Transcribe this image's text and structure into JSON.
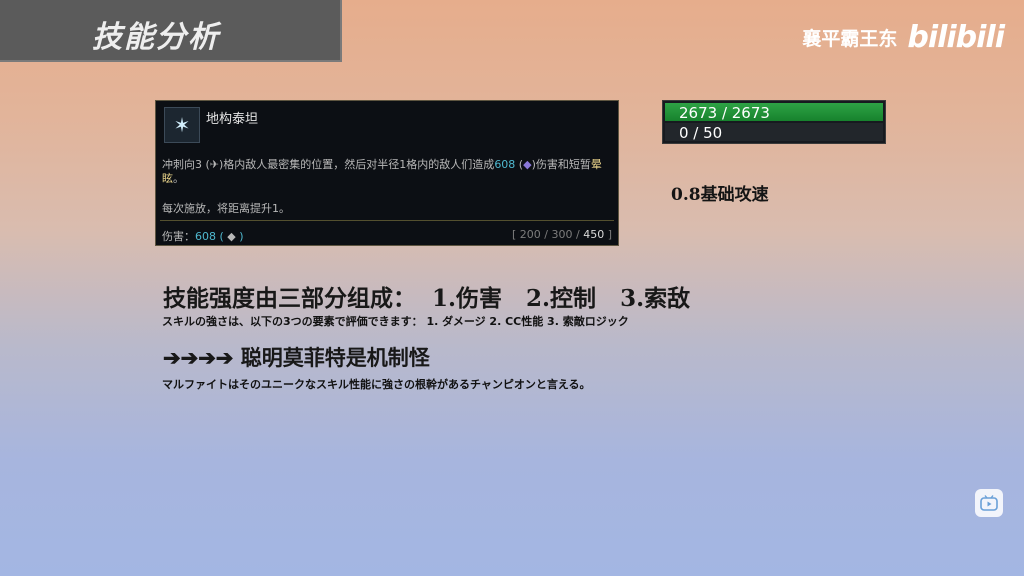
{
  "banner": {
    "title": "技能分析"
  },
  "watermark": {
    "user": "襄平霸王东",
    "logo": "bilibili"
  },
  "skill": {
    "name": "地构泰坦",
    "desc_pre": "冲刺向3 (",
    "desc_mid1": ")格内敌人最密集的位置，然后对半径1格内的敌人们造成",
    "desc_dmg": "608",
    "desc_mid2": ")伤害和短暂",
    "desc_stun": "晕眩",
    "desc_post": "。",
    "note": "每次施放，将距离提升1。",
    "damage_label": "伤害：",
    "damage_value": "608",
    "ranks": [
      "200",
      "300",
      "450"
    ]
  },
  "bars": {
    "hp": "2673 / 2673",
    "mana": "0 / 50",
    "hp_fraction": 1.0,
    "mana_fraction": 0
  },
  "attack_speed": "0.8基础攻速",
  "heading1": "技能强度由三部分组成：  1.伤害   2.控制   3.索敌",
  "sub1": "スキルの強さは、以下の3つの要素で評価できます：  1. ダメージ 2. CC性能 3. 索敵ロジック",
  "heading2": "➔➔➔➔  聪明莫菲特是机制怪",
  "sub2": "マルファイトはそのユニークなスキル性能に強さの根幹があるチャンピオンと言える。",
  "icons": [
    "skill-icon",
    "range-icon",
    "magic-damage-icon",
    "play-icon"
  ],
  "colors": {
    "hp": "#2ea345",
    "magic_value": "#4fb8cf",
    "stun": "#e8d38a"
  }
}
